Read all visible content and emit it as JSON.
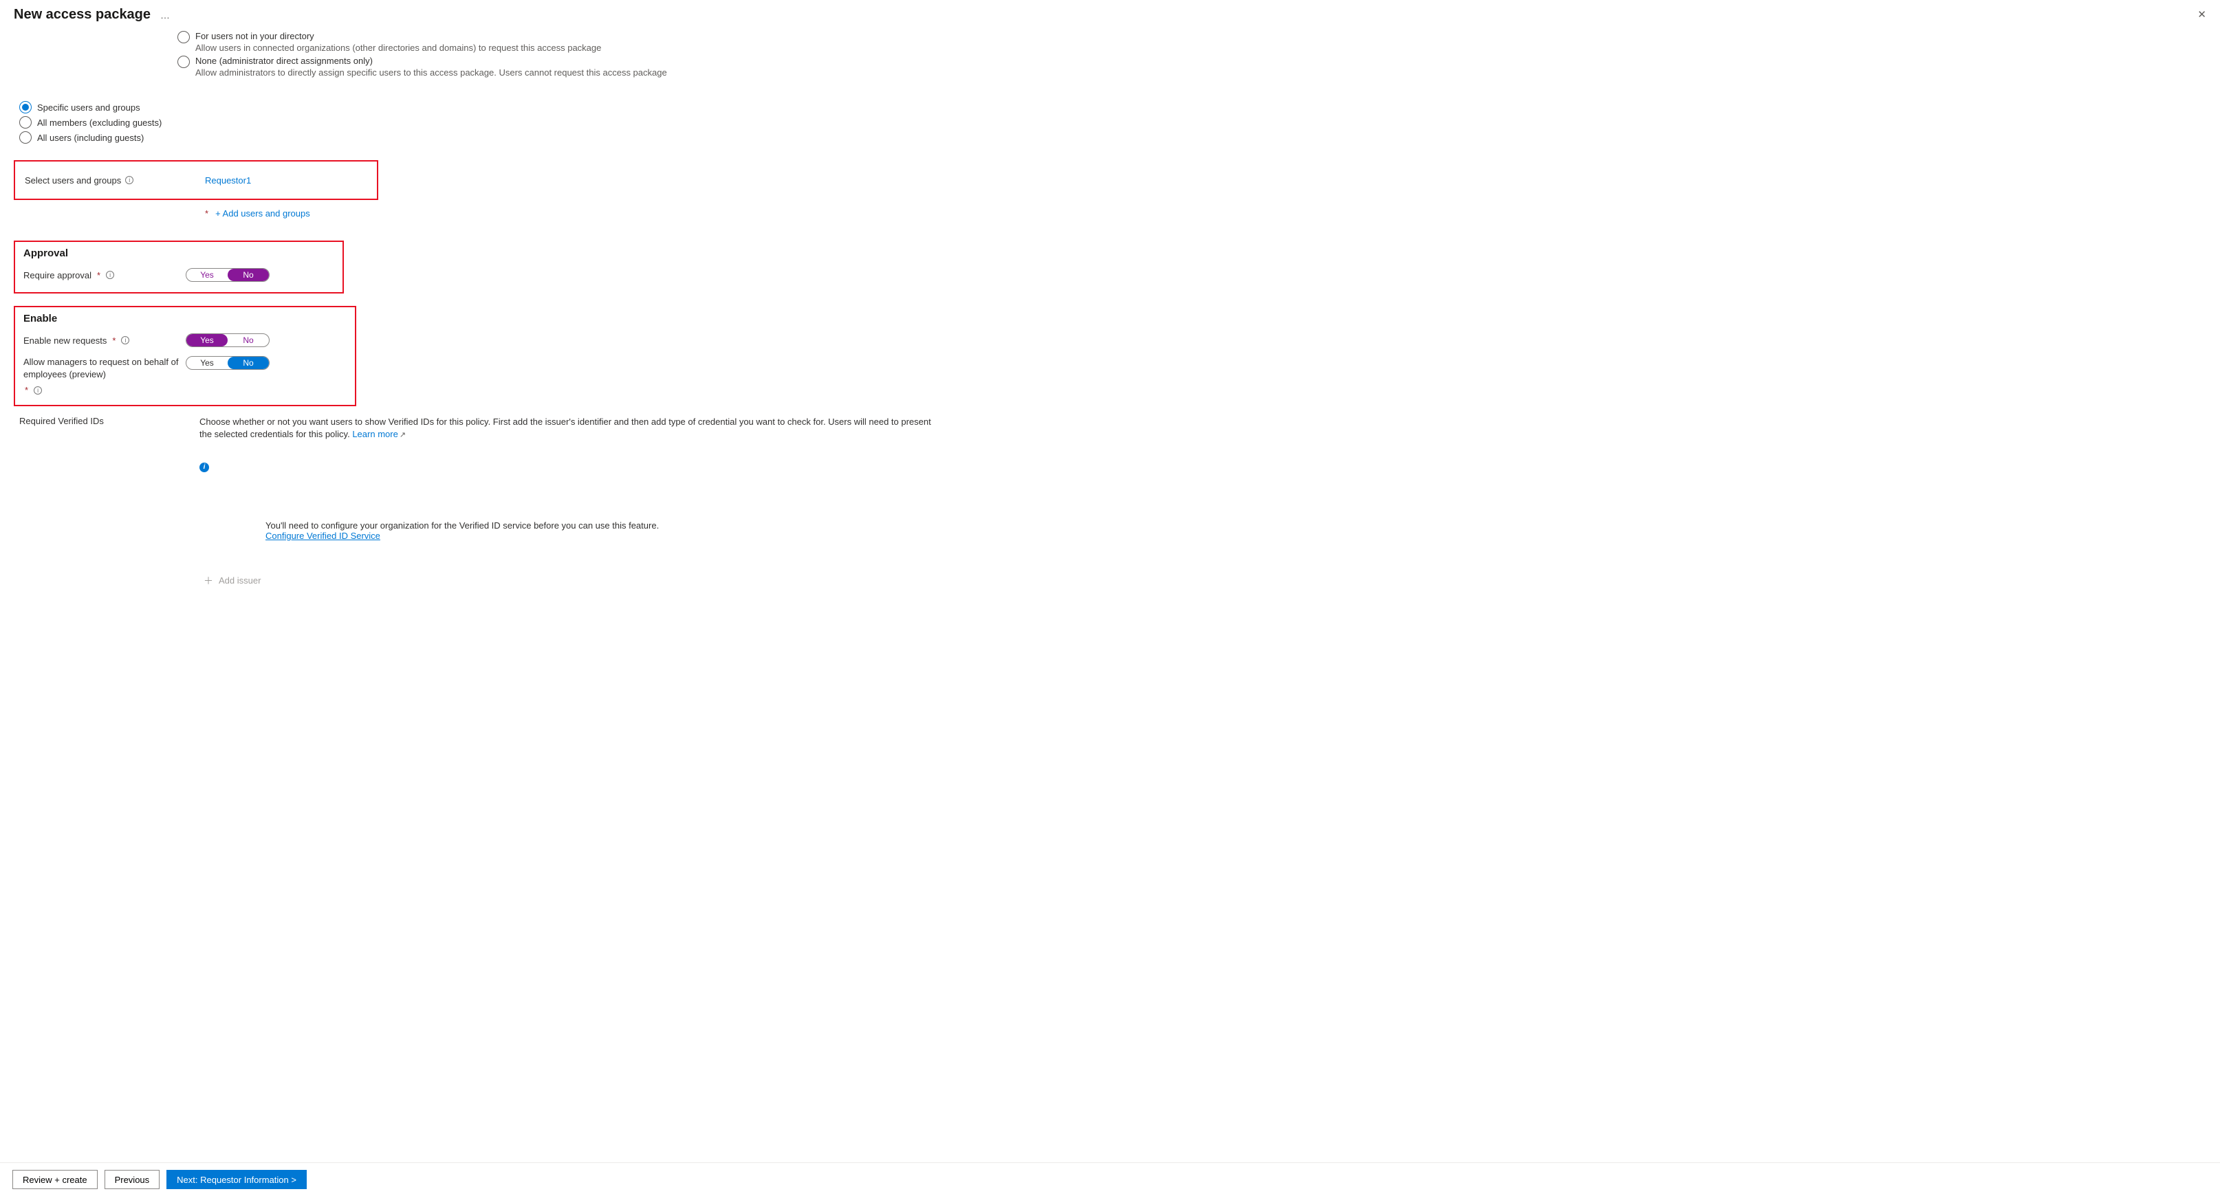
{
  "header": {
    "title": "New access package",
    "more": "…",
    "close": "✕"
  },
  "top_radios": {
    "not_in_dir": {
      "label": "For users not in your directory",
      "desc": "Allow users in connected organizations (other directories and domains) to request this access package"
    },
    "none": {
      "label": "None (administrator direct assignments only)",
      "desc": "Allow administrators to directly assign specific users to this access package. Users cannot request this access package"
    }
  },
  "scope_radios": {
    "specific": "Specific users and groups",
    "members": "All members (excluding guests)",
    "all_users": "All users (including guests)"
  },
  "select_users": {
    "label": "Select users and groups",
    "selected": "Requestor1",
    "add_link": "+ Add users and groups"
  },
  "approval": {
    "section_title": "Approval",
    "require_label": "Require approval",
    "yes": "Yes",
    "no": "No"
  },
  "enable": {
    "section_title": "Enable",
    "new_requests_label": "Enable new requests",
    "managers_label": "Allow managers to request on behalf of employees (preview)",
    "yes": "Yes",
    "no": "No"
  },
  "verified": {
    "section_label": "Required Verified IDs",
    "description": "Choose whether or not you want users to show Verified IDs for this policy. First add the issuer's identifier and then add type of credential you want to check for. Users will need to present the selected credentials for this policy.",
    "learn_more": "Learn more",
    "info_ball": "i",
    "configure_prompt": "You'll need to configure your organization for the Verified ID service before you can use this feature.",
    "configure_link": "Configure Verified ID Service",
    "add_issuer": "Add issuer"
  },
  "footer": {
    "review": "Review + create",
    "previous": "Previous",
    "next": "Next: Requestor Information >"
  }
}
